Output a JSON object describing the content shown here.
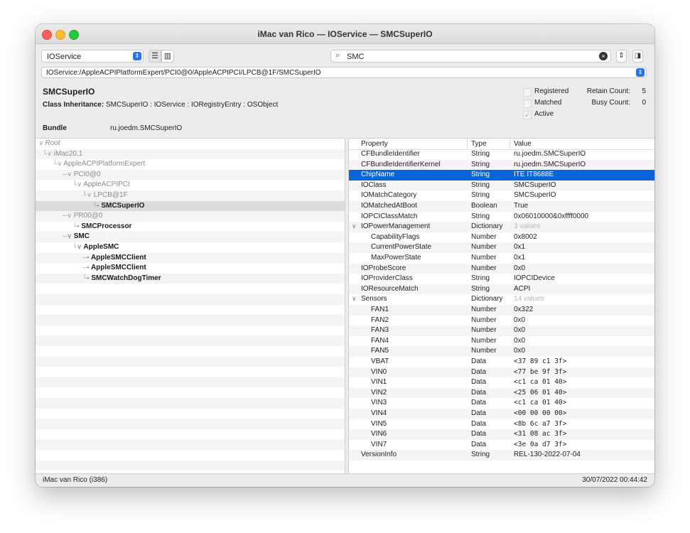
{
  "window": {
    "title": "iMac van Rico — IOService — SMCSuperIO"
  },
  "toolbar": {
    "plane_value": "IOService",
    "search_value": "SMC",
    "path_value": "IOService:/AppleACPIPlatformExpert/PCI0@0/AppleACPIPCI/LPCB@1F/SMCSuperIO"
  },
  "info": {
    "class_name": "SMCSuperIO",
    "inheritance_label": "Class Inheritance:",
    "inheritance_value": "SMCSuperIO : IOService : IORegistryEntry : OSObject",
    "bundle_label": "Bundle",
    "bundle_value": "ru.joedm.SMCSuperIO",
    "flags": [
      {
        "label": "Registered",
        "checked": false
      },
      {
        "label": "Matched",
        "checked": false
      },
      {
        "label": "Active",
        "checked": true
      }
    ],
    "retain_label": "Retain Count:",
    "retain_value": "5",
    "busy_label": "Busy Count:",
    "busy_value": "0"
  },
  "tree": [
    {
      "label": "Root",
      "style": "italic",
      "prefix": "∨"
    },
    {
      "label": "iMac20,1",
      "style": "gray",
      "prefix": "└∨"
    },
    {
      "label": "AppleACPIPlatformExpert",
      "style": "gray",
      "prefix": "└∨"
    },
    {
      "label": "PCI0@0",
      "style": "gray",
      "prefix": "─∨"
    },
    {
      "label": "AppleACPIPCI",
      "style": "gray",
      "prefix": "└∨"
    },
    {
      "label": "LPCB@1F",
      "style": "gray",
      "prefix": "└∨"
    },
    {
      "label": "SMCSuperIO",
      "style": "bold",
      "prefix": "└•",
      "selected": true
    },
    {
      "label": "PR00@0",
      "style": "gray",
      "prefix": "─∨"
    },
    {
      "label": "SMCProcessor",
      "style": "bold",
      "prefix": "└•"
    },
    {
      "label": "SMC",
      "style": "bold",
      "prefix": "─∨"
    },
    {
      "label": "AppleSMC",
      "style": "bold",
      "prefix": "└∨"
    },
    {
      "label": "AppleSMCClient",
      "style": "bold",
      "prefix": "─•"
    },
    {
      "label": "AppleSMCClient",
      "style": "bold",
      "prefix": "─•"
    },
    {
      "label": "SMCWatchDogTimer",
      "style": "bold",
      "prefix": "└•"
    }
  ],
  "properties": {
    "headers": {
      "property": "Property",
      "type": "Type",
      "value": "Value"
    },
    "rows": [
      {
        "property": "CFBundleIdentifier",
        "type": "String",
        "value": "ru.joedm.SMCSuperIO"
      },
      {
        "property": "CFBundleIdentifierKernel",
        "type": "String",
        "value": "ru.joedm.SMCSuperIO"
      },
      {
        "property": "ChipName",
        "type": "String",
        "value": "ITE IT8688E",
        "selected": true
      },
      {
        "property": "IOClass",
        "type": "String",
        "value": "SMCSuperIO"
      },
      {
        "property": "IOMatchCategory",
        "type": "String",
        "value": "SMCSuperIO"
      },
      {
        "property": "IOMatchedAtBoot",
        "type": "Boolean",
        "value": "True"
      },
      {
        "property": "IOPCIClassMatch",
        "type": "String",
        "value": "0x06010000&0xffff0000"
      },
      {
        "property": "IOPowerManagement",
        "type": "Dictionary",
        "value": "3 values",
        "expandable": true,
        "dim": true
      },
      {
        "property": "CapabilityFlags",
        "type": "Number",
        "value": "0x8002",
        "indent": true
      },
      {
        "property": "CurrentPowerState",
        "type": "Number",
        "value": "0x1",
        "indent": true
      },
      {
        "property": "MaxPowerState",
        "type": "Number",
        "value": "0x1",
        "indent": true
      },
      {
        "property": "IOProbeScore",
        "type": "Number",
        "value": "0x0"
      },
      {
        "property": "IOProviderClass",
        "type": "String",
        "value": "IOPCIDevice"
      },
      {
        "property": "IOResourceMatch",
        "type": "String",
        "value": "ACPI"
      },
      {
        "property": "Sensors",
        "type": "Dictionary",
        "value": "14 values",
        "expandable": true,
        "dim": true
      },
      {
        "property": "FAN1",
        "type": "Number",
        "value": "0x322",
        "indent": true
      },
      {
        "property": "FAN2",
        "type": "Number",
        "value": "0x0",
        "indent": true
      },
      {
        "property": "FAN3",
        "type": "Number",
        "value": "0x0",
        "indent": true
      },
      {
        "property": "FAN4",
        "type": "Number",
        "value": "0x0",
        "indent": true
      },
      {
        "property": "FAN5",
        "type": "Number",
        "value": "0x0",
        "indent": true
      },
      {
        "property": "VBAT",
        "type": "Data",
        "value": "<37 89 c1 3f>",
        "indent": true,
        "mono": true
      },
      {
        "property": "VIN0",
        "type": "Data",
        "value": "<77 be 9f 3f>",
        "indent": true,
        "mono": true
      },
      {
        "property": "VIN1",
        "type": "Data",
        "value": "<c1 ca 01 40>",
        "indent": true,
        "mono": true
      },
      {
        "property": "VIN2",
        "type": "Data",
        "value": "<25 06 01 40>",
        "indent": true,
        "mono": true
      },
      {
        "property": "VIN3",
        "type": "Data",
        "value": "<c1 ca 01 40>",
        "indent": true,
        "mono": true
      },
      {
        "property": "VIN4",
        "type": "Data",
        "value": "<00 00 00 00>",
        "indent": true,
        "mono": true
      },
      {
        "property": "VIN5",
        "type": "Data",
        "value": "<8b 6c a7 3f>",
        "indent": true,
        "mono": true
      },
      {
        "property": "VIN6",
        "type": "Data",
        "value": "<31 08 ac 3f>",
        "indent": true,
        "mono": true
      },
      {
        "property": "VIN7",
        "type": "Data",
        "value": "<3e 0a d7 3f>",
        "indent": true,
        "mono": true
      },
      {
        "property": "VersionInfo",
        "type": "String",
        "value": "REL-130-2022-07-04"
      }
    ]
  },
  "status": {
    "left": "iMac van Rico (i386)",
    "right": "30/07/2022 00:44:42"
  },
  "colors": {
    "selection": "#0a63d8",
    "accent": "#2a72e8"
  }
}
